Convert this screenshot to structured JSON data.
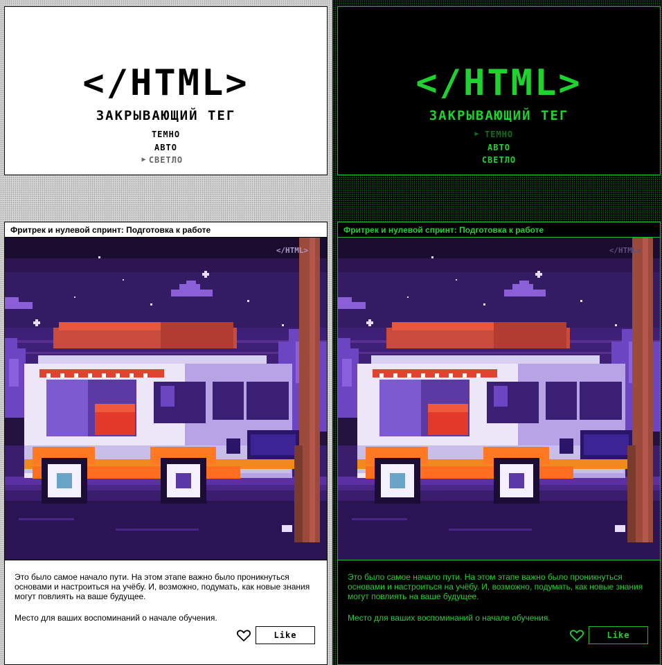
{
  "colors": {
    "light_text": "#000000",
    "light_bg": "#ffffff",
    "dark_accent": "#1fd32e",
    "dark_bg": "#000000",
    "active_dim_green": "#0d6f19"
  },
  "light": {
    "header": {
      "logo": "</HTML>",
      "subtitle": "ЗАКРЫВАЮЩИЙ ТЕГ",
      "theme_menu": {
        "marker": "▶",
        "items": [
          "ТЕМНО",
          "АВТО",
          "СВЕТЛО"
        ],
        "selected": "СВЕТЛО"
      }
    },
    "card": {
      "title": "Фритрек и нулевой спринт: Подготовка к работе",
      "image": {
        "watermark": "</HTML>",
        "alt_icon": "food-truck-illustration"
      },
      "paragraph_1": "Это было самое начало пути. На этом этапе важно было проникнуться основами и настроиться на учёбу. И, возможно, подумать, как новые знания могут повлиять на ваше будущее.",
      "paragraph_2": "Место для ваших воспоминаний о начале обучения.",
      "heart_icon": "heart-outline-icon",
      "like_label": "Like"
    }
  },
  "dark": {
    "header": {
      "logo": "</HTML>",
      "subtitle": "ЗАКРЫВАЮЩИЙ ТЕГ",
      "theme_menu": {
        "marker": "▶",
        "items": [
          "ТЕМНО",
          "АВТО",
          "СВЕТЛО"
        ],
        "selected": "ТЕМНО"
      }
    },
    "card": {
      "title": "Фритрек и нулевой спринт: Подготовка к работе",
      "image": {
        "watermark": "</HTML>",
        "alt_icon": "food-truck-illustration"
      },
      "paragraph_1": "Это было самое начало пути. На этом этапе важно было проникнуться основами и настроиться на учёбу. И, возможно, подумать, как новые знания могут повлиять на ваше будущее.",
      "paragraph_2": "Место для ваших воспоминаний о начале обучения.",
      "heart_icon": "heart-outline-icon",
      "like_label": "Like"
    }
  }
}
